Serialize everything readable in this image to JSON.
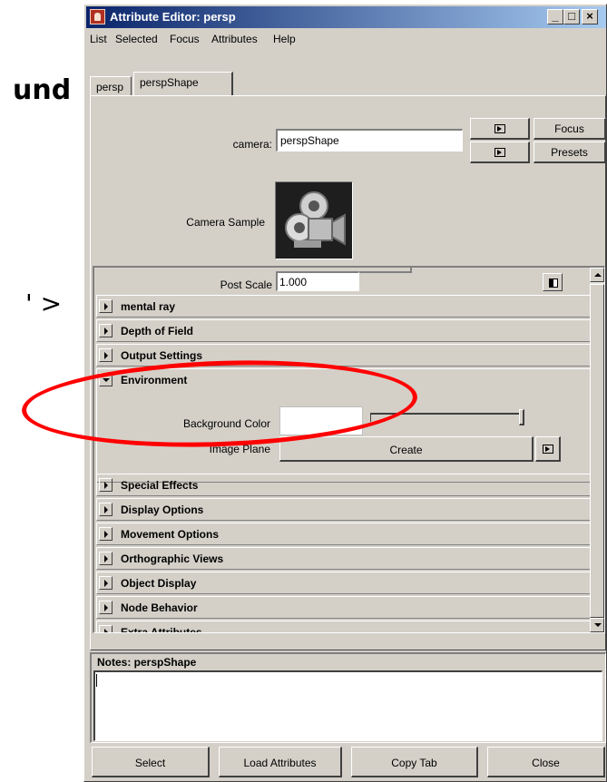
{
  "background_slide": {
    "text_line1": "und",
    "text_line2": "' >"
  },
  "window": {
    "title": "Attribute Editor: persp",
    "controls": {
      "minimize": "_",
      "maximize": "□",
      "close": "×"
    }
  },
  "menubar": {
    "items": [
      "List",
      "Selected",
      "Focus",
      "Attributes",
      "Help"
    ]
  },
  "tabs": [
    {
      "label": "persp",
      "active": false
    },
    {
      "label": "perspShape",
      "active": true
    }
  ],
  "header": {
    "camera_label": "camera:",
    "camera_value": "perspShape",
    "focus_button": "Focus",
    "presets_button": "Presets",
    "sample_label": "Camera Sample"
  },
  "attributes": {
    "post_scale": {
      "label": "Post Scale",
      "value": "1.000"
    },
    "sections": [
      {
        "label": "mental ray",
        "expanded": false
      },
      {
        "label": "Depth of Field",
        "expanded": false
      },
      {
        "label": "Output Settings",
        "expanded": false
      },
      {
        "label": "Environment",
        "expanded": true
      },
      {
        "label": "Special Effects",
        "expanded": false
      },
      {
        "label": "Display Options",
        "expanded": false
      },
      {
        "label": "Movement Options",
        "expanded": false
      },
      {
        "label": "Orthographic Views",
        "expanded": false
      },
      {
        "label": "Object Display",
        "expanded": false
      },
      {
        "label": "Node Behavior",
        "expanded": false
      },
      {
        "label": "Extra Attributes",
        "expanded": false
      }
    ],
    "environment": {
      "background_color_label": "Background Color",
      "background_color_value": "#ffffff",
      "image_plane_label": "Image Plane",
      "create_button": "Create"
    }
  },
  "notes": {
    "title": "Notes:  perspShape",
    "value": ""
  },
  "bottom_buttons": {
    "select": "Select",
    "load_attributes": "Load Attributes",
    "copy_tab": "Copy Tab",
    "close": "Close"
  },
  "colors": {
    "title_gradient_start": "#0a246a",
    "title_gradient_end": "#a6caf0",
    "panel_bg": "#d4d0c8",
    "highlight_ellipse": "#ff0000"
  }
}
